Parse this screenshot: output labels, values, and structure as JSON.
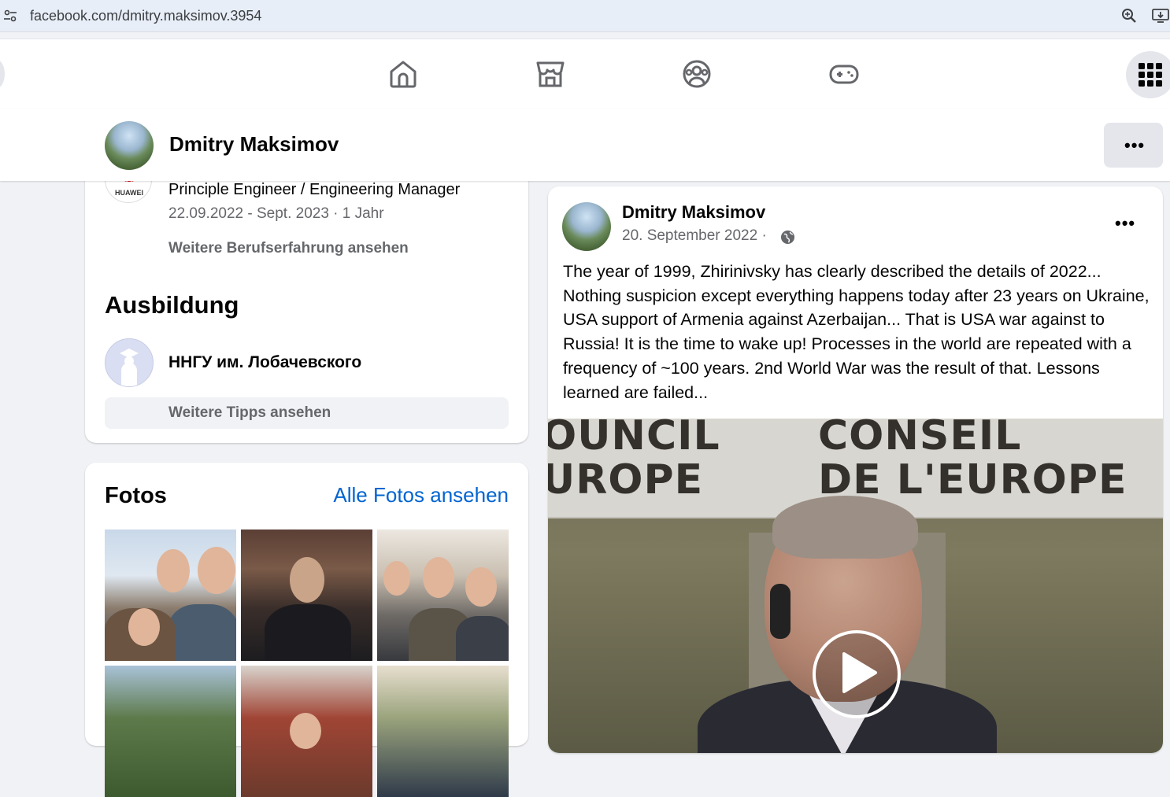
{
  "browser": {
    "url": "facebook.com/dmitry.maksimov.3954"
  },
  "profile_header": {
    "name": "Dmitry Maksimov",
    "more_label": "•••"
  },
  "intro": {
    "company_logo_text": "HUAWEI",
    "job_title": "Principle Engineer / Engineering Manager",
    "job_dates": "22.09.2022 - Sept. 2023 · 1 Jahr",
    "more_experience": "Weitere Berufserfahrung ansehen",
    "education_heading": "Ausbildung",
    "school_name": "ННГУ им. Лобачевского",
    "more_tips": "Weitere Tipps ansehen"
  },
  "photos": {
    "heading": "Fotos",
    "all_link": "Alle Fotos ansehen",
    "count_visible": 6
  },
  "post": {
    "author": "Dmitry Maksimov",
    "date": "20. September 2022 ·",
    "privacy_icon": "globe-icon",
    "menu_label": "•••",
    "text": "The year of 1999, Zhirinivsky has clearly described the details of 2022... Nothing suspicion except everything happens today after 23 years on Ukraine, USA support of Armenia against Azerbaijan... That is USA war against to Russia! It is the time to wake up! Processes in the world are repeated with a frequency of ~100 years.  2nd World War was the result of that.  Lessons learned are failed...",
    "video_banner_left": [
      "OUNCIL",
      "UROPE"
    ],
    "video_banner_right": [
      "CONSEIL",
      "DE L'EUROPE"
    ]
  },
  "colors": {
    "page_bg": "#f0f2f5",
    "link_blue": "#0064d1",
    "secondary_text": "#65676b",
    "button_grey": "#e4e6eb"
  }
}
